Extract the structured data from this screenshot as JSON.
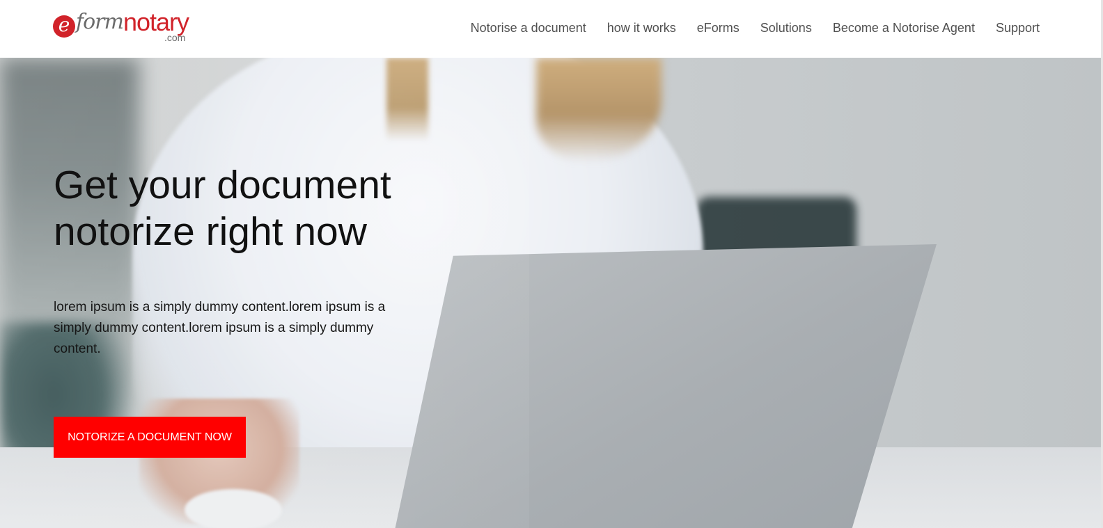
{
  "brand": {
    "logo_text": "eformnotary.com"
  },
  "nav": {
    "items": [
      {
        "label": "Notorise a document"
      },
      {
        "label": "how it works"
      },
      {
        "label": "eForms"
      },
      {
        "label": "Solutions"
      },
      {
        "label": "Become a Notorise Agent"
      },
      {
        "label": "Support"
      }
    ]
  },
  "hero": {
    "title_line1": "Get your document",
    "title_line2": "notorize right now",
    "description": "lorem ipsum is a simply dummy content.lorem ipsum is a simply dummy content.lorem ipsum is a simply dummy content.",
    "cta_label": "NOTORIZE A DOCUMENT NOW"
  },
  "colors": {
    "accent": "#ff0000",
    "logo_red": "#d1232a",
    "nav_text": "#505050"
  }
}
